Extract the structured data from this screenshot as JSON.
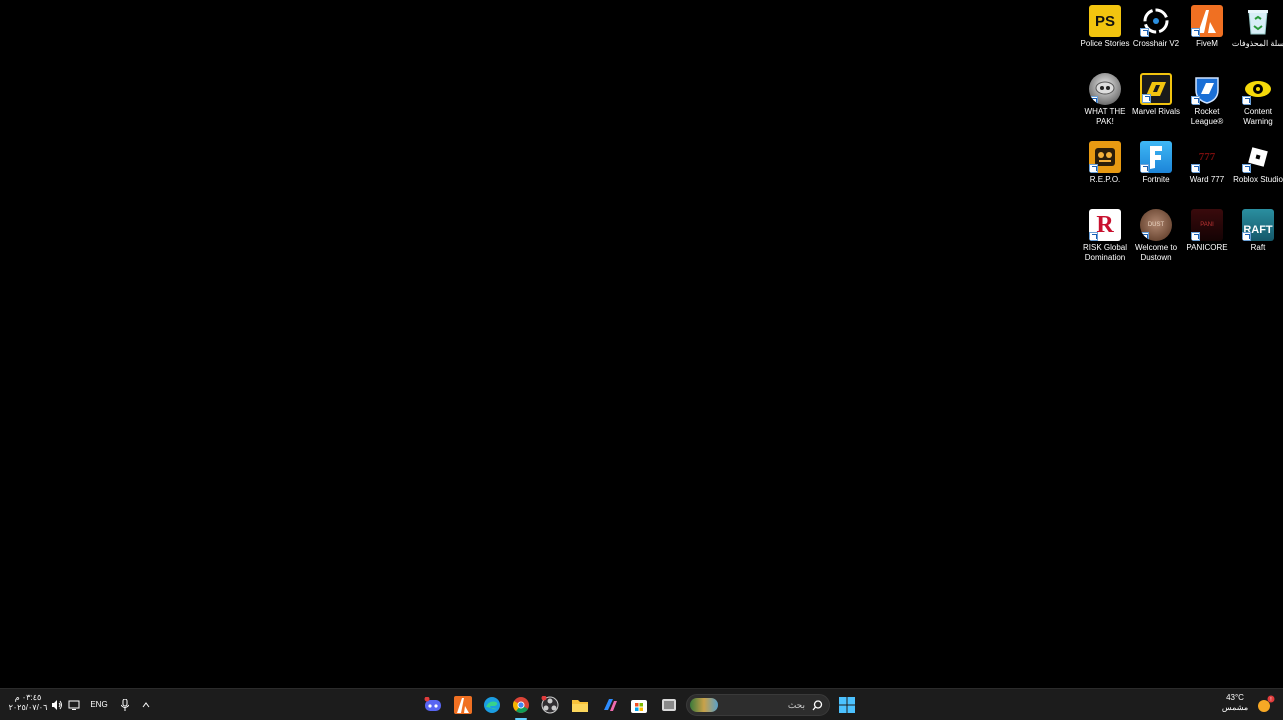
{
  "desktop": {
    "icons": [
      {
        "label": "Police Stories",
        "icon": "police-stories-icon"
      },
      {
        "label": "Crosshair V2",
        "icon": "crosshair-icon"
      },
      {
        "label": "FiveM",
        "icon": "fivem-icon"
      },
      {
        "label": "سلة المحذوفات",
        "icon": "recycle-bin-icon"
      },
      {
        "label": "WHAT THE PAK!",
        "icon": "what-the-pak-icon"
      },
      {
        "label": "Marvel Rivals",
        "icon": "marvel-rivals-icon"
      },
      {
        "label": "Rocket League®",
        "icon": "rocket-league-icon"
      },
      {
        "label": "Content Warning",
        "icon": "content-warning-icon"
      },
      {
        "label": "R.E.P.O.",
        "icon": "repo-icon"
      },
      {
        "label": "Fortnite",
        "icon": "fortnite-icon"
      },
      {
        "label": "Ward 777",
        "icon": "ward-777-icon"
      },
      {
        "label": "Roblox Studio",
        "icon": "roblox-studio-icon"
      },
      {
        "label": "RISK Global Domination",
        "icon": "risk-icon"
      },
      {
        "label": "Welcome to Dustown",
        "icon": "dustown-icon"
      },
      {
        "label": "PANICORE",
        "icon": "panicore-icon"
      },
      {
        "label": "Raft",
        "icon": "raft-icon"
      }
    ]
  },
  "taskbar": {
    "clock": {
      "time": "٠٣:٤٥ م",
      "date": "٢٠٢٥/٠٧/٠٦"
    },
    "language": "ENG",
    "search_placeholder": "بحث",
    "weather": {
      "temp": "43°C",
      "condition": "مشمس"
    },
    "apps": [
      "discord-icon",
      "fivem-icon",
      "edge-icon",
      "chrome-icon",
      "obs-icon",
      "file-explorer-icon",
      "copilot-icon",
      "store-icon",
      "task-view-icon"
    ],
    "colors": {
      "bar": "#1c1c1c",
      "accent": "#0078d4"
    }
  }
}
